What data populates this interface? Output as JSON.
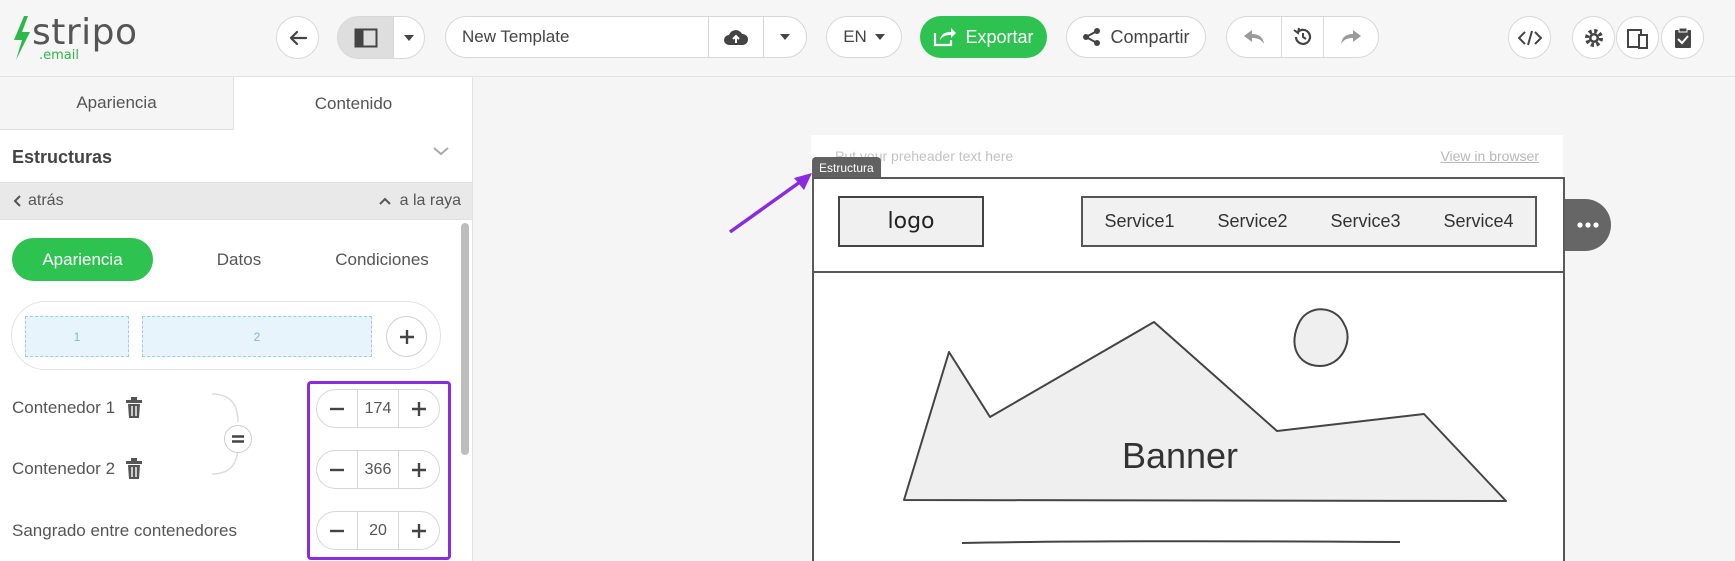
{
  "header": {
    "logo_text": "stripo",
    "logo_sub": ".email",
    "template_name": "New Template",
    "language": "EN",
    "export_label": "Exportar",
    "share_label": "Compartir",
    "icons": [
      "back-arrow-icon",
      "layout-icon",
      "chevron-down-icon",
      "cloud-upload-icon",
      "undo-icon",
      "history-icon",
      "redo-icon",
      "code-icon",
      "gear-icon",
      "device-preview-icon",
      "clipboard-check-icon"
    ],
    "colors": {
      "accent": "#2ec350"
    }
  },
  "panel": {
    "tabs": [
      {
        "label": "Apariencia"
      },
      {
        "label": "Contenido"
      }
    ],
    "active_tab": "Contenido",
    "section_title": "Estructuras",
    "back_label": "atrás",
    "raya_label": "a la raya",
    "subtabs": [
      {
        "label": "Apariencia"
      },
      {
        "label": "Datos"
      },
      {
        "label": "Condiciones"
      }
    ],
    "active_subtab": "Apariencia",
    "columns": [
      {
        "label": "1"
      },
      {
        "label": "2"
      }
    ],
    "rows": [
      {
        "label": "Contenedor 1",
        "value": "174"
      },
      {
        "label": "Contenedor 2",
        "value": "366"
      },
      {
        "label": "Sangrado entre contenedores",
        "value": "20"
      }
    ]
  },
  "canvas": {
    "preheader": "Put your preheader text here",
    "view_in_browser": "View in browser",
    "structure_tag": "Estructura",
    "email_logo": "logo",
    "services": [
      {
        "label": "Service1"
      },
      {
        "label": "Service2"
      },
      {
        "label": "Service3"
      },
      {
        "label": "Service4"
      }
    ],
    "banner_label": "Banner",
    "highlight_color": "#8a2be2"
  }
}
